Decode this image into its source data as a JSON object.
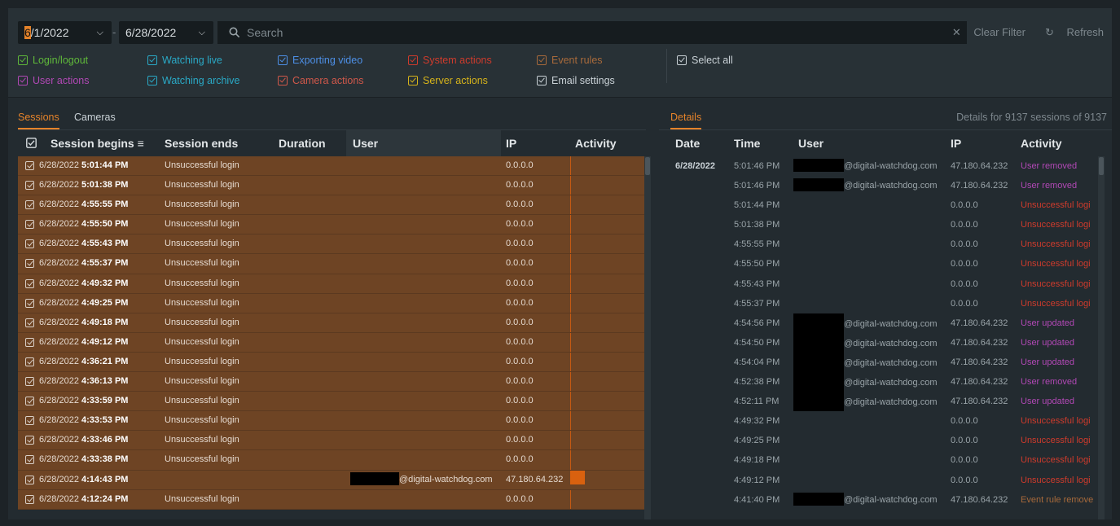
{
  "toolbar": {
    "date_from": "6/1/2022",
    "date_from_cursor": "6",
    "date_from_rest": "/1/2022",
    "date_to": "6/28/2022",
    "date_separator": "-",
    "search_placeholder": "Search",
    "clear_filter": "Clear Filter",
    "refresh": "Refresh"
  },
  "filters": [
    {
      "label": "Login/logout",
      "color": "#5fb83a"
    },
    {
      "label": "Watching live",
      "color": "#2aa9c6"
    },
    {
      "label": "Exporting video",
      "color": "#4d8fe6"
    },
    {
      "label": "System actions",
      "color": "#cf3b2c"
    },
    {
      "label": "Event rules",
      "color": "#a86a3b"
    },
    {
      "label": "User actions",
      "color": "#b148b5"
    },
    {
      "label": "Watching archive",
      "color": "#2aa9c6"
    },
    {
      "label": "Camera actions",
      "color": "#d0584a"
    },
    {
      "label": "Server actions",
      "color": "#d6b31b"
    },
    {
      "label": "Email settings",
      "color": "#c9d1d6"
    },
    {
      "label": "Select all",
      "color": "#c9d1d6"
    }
  ],
  "sessions": {
    "tabs": [
      "Sessions",
      "Cameras"
    ],
    "columns": [
      "Session begins",
      "Session ends",
      "Duration",
      "User",
      "IP",
      "Activity"
    ],
    "rows": [
      {
        "date": "6/28/2022",
        "time": "5:01:44 PM",
        "ends": "Unsuccessful login",
        "user": "",
        "ip": "0.0.0.0"
      },
      {
        "date": "6/28/2022",
        "time": "5:01:38 PM",
        "ends": "Unsuccessful login",
        "user": "",
        "ip": "0.0.0.0"
      },
      {
        "date": "6/28/2022",
        "time": "4:55:55 PM",
        "ends": "Unsuccessful login",
        "user": "",
        "ip": "0.0.0.0"
      },
      {
        "date": "6/28/2022",
        "time": "4:55:50 PM",
        "ends": "Unsuccessful login",
        "user": "",
        "ip": "0.0.0.0"
      },
      {
        "date": "6/28/2022",
        "time": "4:55:43 PM",
        "ends": "Unsuccessful login",
        "user": "",
        "ip": "0.0.0.0"
      },
      {
        "date": "6/28/2022",
        "time": "4:55:37 PM",
        "ends": "Unsuccessful login",
        "user": "",
        "ip": "0.0.0.0"
      },
      {
        "date": "6/28/2022",
        "time": "4:49:32 PM",
        "ends": "Unsuccessful login",
        "user": "",
        "ip": "0.0.0.0"
      },
      {
        "date": "6/28/2022",
        "time": "4:49:25 PM",
        "ends": "Unsuccessful login",
        "user": "",
        "ip": "0.0.0.0"
      },
      {
        "date": "6/28/2022",
        "time": "4:49:18 PM",
        "ends": "Unsuccessful login",
        "user": "",
        "ip": "0.0.0.0"
      },
      {
        "date": "6/28/2022",
        "time": "4:49:12 PM",
        "ends": "Unsuccessful login",
        "user": "",
        "ip": "0.0.0.0"
      },
      {
        "date": "6/28/2022",
        "time": "4:36:21 PM",
        "ends": "Unsuccessful login",
        "user": "",
        "ip": "0.0.0.0"
      },
      {
        "date": "6/28/2022",
        "time": "4:36:13 PM",
        "ends": "Unsuccessful login",
        "user": "",
        "ip": "0.0.0.0"
      },
      {
        "date": "6/28/2022",
        "time": "4:33:59 PM",
        "ends": "Unsuccessful login",
        "user": "",
        "ip": "0.0.0.0"
      },
      {
        "date": "6/28/2022",
        "time": "4:33:53 PM",
        "ends": "Unsuccessful login",
        "user": "",
        "ip": "0.0.0.0"
      },
      {
        "date": "6/28/2022",
        "time": "4:33:46 PM",
        "ends": "Unsuccessful login",
        "user": "",
        "ip": "0.0.0.0"
      },
      {
        "date": "6/28/2022",
        "time": "4:33:38 PM",
        "ends": "Unsuccessful login",
        "user": "",
        "ip": "0.0.0.0"
      },
      {
        "date": "6/28/2022",
        "time": "4:14:43 PM",
        "ends": "",
        "user": "@digital-watchdog.com",
        "ip": "47.180.64.232"
      },
      {
        "date": "6/28/2022",
        "time": "4:12:24 PM",
        "ends": "Unsuccessful login",
        "user": "",
        "ip": "0.0.0.0"
      }
    ]
  },
  "details": {
    "tab": "Details",
    "summary": "Details for 9137 sessions of 9137",
    "columns": [
      "Date",
      "Time",
      "User",
      "IP",
      "Activity"
    ],
    "rows": [
      {
        "date": "6/28/2022",
        "time": "5:01:46 PM",
        "user": "@digital-watchdog.com",
        "ip": "47.180.64.232",
        "activity": "User removed",
        "kind": "user"
      },
      {
        "date": "",
        "time": "5:01:46 PM",
        "user": "@digital-watchdog.com",
        "ip": "47.180.64.232",
        "activity": "User removed",
        "kind": "user"
      },
      {
        "date": "",
        "time": "5:01:44 PM",
        "user": "",
        "ip": "0.0.0.0",
        "activity": "Unsuccessful logi",
        "kind": "login"
      },
      {
        "date": "",
        "time": "5:01:38 PM",
        "user": "",
        "ip": "0.0.0.0",
        "activity": "Unsuccessful logi",
        "kind": "login"
      },
      {
        "date": "",
        "time": "4:55:55 PM",
        "user": "",
        "ip": "0.0.0.0",
        "activity": "Unsuccessful logi",
        "kind": "login"
      },
      {
        "date": "",
        "time": "4:55:50 PM",
        "user": "",
        "ip": "0.0.0.0",
        "activity": "Unsuccessful logi",
        "kind": "login"
      },
      {
        "date": "",
        "time": "4:55:43 PM",
        "user": "",
        "ip": "0.0.0.0",
        "activity": "Unsuccessful logi",
        "kind": "login"
      },
      {
        "date": "",
        "time": "4:55:37 PM",
        "user": "",
        "ip": "0.0.0.0",
        "activity": "Unsuccessful logi",
        "kind": "login"
      },
      {
        "date": "",
        "time": "4:54:56 PM",
        "user": "@digital-watchdog.com",
        "ip": "47.180.64.232",
        "activity": "User updated",
        "kind": "user"
      },
      {
        "date": "",
        "time": "4:54:50 PM",
        "user": "@digital-watchdog.com",
        "ip": "47.180.64.232",
        "activity": "User updated",
        "kind": "user"
      },
      {
        "date": "",
        "time": "4:54:04 PM",
        "user": "@digital-watchdog.com",
        "ip": "47.180.64.232",
        "activity": "User updated",
        "kind": "user"
      },
      {
        "date": "",
        "time": "4:52:38 PM",
        "user": "@digital-watchdog.com",
        "ip": "47.180.64.232",
        "activity": "User removed",
        "kind": "user"
      },
      {
        "date": "",
        "time": "4:52:11 PM",
        "user": "@digital-watchdog.com",
        "ip": "47.180.64.232",
        "activity": "User updated",
        "kind": "user"
      },
      {
        "date": "",
        "time": "4:49:32 PM",
        "user": "",
        "ip": "0.0.0.0",
        "activity": "Unsuccessful logi",
        "kind": "login"
      },
      {
        "date": "",
        "time": "4:49:25 PM",
        "user": "",
        "ip": "0.0.0.0",
        "activity": "Unsuccessful logi",
        "kind": "login"
      },
      {
        "date": "",
        "time": "4:49:18 PM",
        "user": "",
        "ip": "0.0.0.0",
        "activity": "Unsuccessful logi",
        "kind": "login"
      },
      {
        "date": "",
        "time": "4:49:12 PM",
        "user": "",
        "ip": "0.0.0.0",
        "activity": "Unsuccessful logi",
        "kind": "login"
      },
      {
        "date": "",
        "time": "4:41:40 PM",
        "user": "@digital-watchdog.com",
        "ip": "47.180.64.232",
        "activity": "Event rule remove",
        "kind": "rule"
      }
    ]
  },
  "colors": {
    "accent": "#e5832a",
    "row_highlight": "#6e4424",
    "user_action": "#b148b5",
    "failed_login": "#cf3b2c",
    "event_rule": "#a86a3b"
  }
}
